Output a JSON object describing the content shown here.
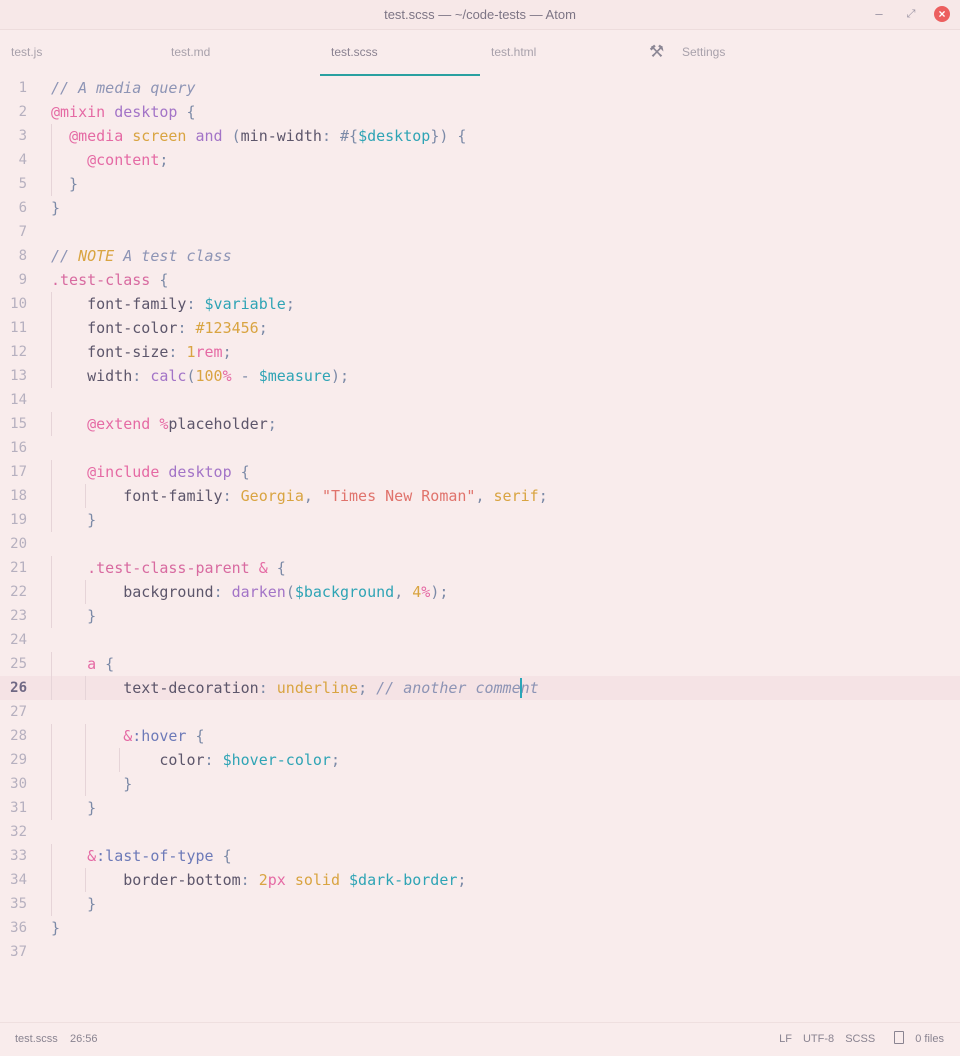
{
  "window": {
    "title": "test.scss — ~/code-tests — Atom",
    "minimize_glyph": "–",
    "maximize_glyph": "⤢",
    "close_glyph": "×"
  },
  "tabs": [
    {
      "label": "test.js",
      "active": false
    },
    {
      "label": "test.md",
      "active": false
    },
    {
      "label": "test.scss",
      "active": true
    },
    {
      "label": "test.html",
      "active": false
    },
    {
      "label": "Settings",
      "active": false,
      "icon": "tools-icon"
    }
  ],
  "editor": {
    "cursor_line": 26,
    "lines": [
      {
        "n": "1",
        "tokens": [
          [
            "// A media query",
            "cm"
          ]
        ]
      },
      {
        "n": "2",
        "tokens": [
          [
            "@",
            "at"
          ],
          [
            "mixin",
            "at"
          ],
          [
            " ",
            "pr"
          ],
          [
            "desktop",
            "kw"
          ],
          [
            " {",
            "pu"
          ]
        ]
      },
      {
        "n": "3",
        "tokens": [
          [
            "  ",
            "pr"
          ],
          [
            "@media",
            "at"
          ],
          [
            " ",
            "pr"
          ],
          [
            "screen",
            "vl"
          ],
          [
            " ",
            "pr"
          ],
          [
            "and",
            "kw"
          ],
          [
            " (",
            "pu"
          ],
          [
            "min-width",
            "pr"
          ],
          [
            ": ",
            "pu"
          ],
          [
            "#{",
            "pu"
          ],
          [
            "$desktop",
            "vr"
          ],
          [
            "}",
            "pu"
          ],
          [
            ") {",
            "pu"
          ]
        ]
      },
      {
        "n": "4",
        "tokens": [
          [
            "    ",
            "pr"
          ],
          [
            "@content",
            "at"
          ],
          [
            ";",
            "pu"
          ]
        ]
      },
      {
        "n": "5",
        "tokens": [
          [
            "  }",
            "pu"
          ]
        ]
      },
      {
        "n": "6",
        "tokens": [
          [
            "}",
            "pu"
          ]
        ]
      },
      {
        "n": "7",
        "tokens": []
      },
      {
        "n": "8",
        "tokens": [
          [
            "// ",
            "cm"
          ],
          [
            "NOTE",
            "nt"
          ],
          [
            " A test class",
            "cm"
          ]
        ]
      },
      {
        "n": "9",
        "tokens": [
          [
            ".test-class",
            "sl"
          ],
          [
            " {",
            "pu"
          ]
        ]
      },
      {
        "n": "10",
        "tokens": [
          [
            "    ",
            "pr"
          ],
          [
            "font-family",
            "pr"
          ],
          [
            ": ",
            "pu"
          ],
          [
            "$variable",
            "vr"
          ],
          [
            ";",
            "pu"
          ]
        ]
      },
      {
        "n": "11",
        "tokens": [
          [
            "    ",
            "pr"
          ],
          [
            "font-color",
            "pr"
          ],
          [
            ": ",
            "pu"
          ],
          [
            "#123456",
            "nm"
          ],
          [
            ";",
            "pu"
          ]
        ]
      },
      {
        "n": "12",
        "tokens": [
          [
            "    ",
            "pr"
          ],
          [
            "font-size",
            "pr"
          ],
          [
            ": ",
            "pu"
          ],
          [
            "1",
            "nm"
          ],
          [
            "rem",
            "at"
          ],
          [
            ";",
            "pu"
          ]
        ]
      },
      {
        "n": "13",
        "tokens": [
          [
            "    ",
            "pr"
          ],
          [
            "width",
            "pr"
          ],
          [
            ": ",
            "pu"
          ],
          [
            "calc",
            "fn"
          ],
          [
            "(",
            "pu"
          ],
          [
            "100",
            "nm"
          ],
          [
            "%",
            "at"
          ],
          [
            " - ",
            "pu"
          ],
          [
            "$measure",
            "vr"
          ],
          [
            ");",
            "pu"
          ]
        ]
      },
      {
        "n": "14",
        "tokens": []
      },
      {
        "n": "15",
        "tokens": [
          [
            "    ",
            "pr"
          ],
          [
            "@extend",
            "at"
          ],
          [
            " ",
            "pr"
          ],
          [
            "%",
            "at"
          ],
          [
            "placeholder",
            ""
          ],
          [
            ";",
            "pu"
          ]
        ]
      },
      {
        "n": "16",
        "tokens": []
      },
      {
        "n": "17",
        "tokens": [
          [
            "    ",
            "pr"
          ],
          [
            "@include",
            "at"
          ],
          [
            " ",
            "pr"
          ],
          [
            "desktop",
            "kw"
          ],
          [
            " {",
            "pu"
          ]
        ]
      },
      {
        "n": "18",
        "tokens": [
          [
            "        ",
            "pr"
          ],
          [
            "font-family",
            "pr"
          ],
          [
            ": ",
            "pu"
          ],
          [
            "Georgia",
            "vl"
          ],
          [
            ", ",
            "pu"
          ],
          [
            "\"Times New Roman\"",
            "st"
          ],
          [
            ", ",
            "pu"
          ],
          [
            "serif",
            "vl"
          ],
          [
            ";",
            "pu"
          ]
        ]
      },
      {
        "n": "19",
        "tokens": [
          [
            "    }",
            "pu"
          ]
        ]
      },
      {
        "n": "20",
        "tokens": []
      },
      {
        "n": "21",
        "tokens": [
          [
            "    ",
            "pr"
          ],
          [
            ".test-class-parent",
            "sl"
          ],
          [
            " ",
            "pr"
          ],
          [
            "&",
            "at"
          ],
          [
            " {",
            "pu"
          ]
        ]
      },
      {
        "n": "22",
        "tokens": [
          [
            "        ",
            "pr"
          ],
          [
            "background",
            "pr"
          ],
          [
            ": ",
            "pu"
          ],
          [
            "darken",
            "fn"
          ],
          [
            "(",
            "pu"
          ],
          [
            "$background",
            "vr"
          ],
          [
            ", ",
            "pu"
          ],
          [
            "4",
            "nm"
          ],
          [
            "%",
            "at"
          ],
          [
            ");",
            "pu"
          ]
        ]
      },
      {
        "n": "23",
        "tokens": [
          [
            "    }",
            "pu"
          ]
        ]
      },
      {
        "n": "24",
        "tokens": []
      },
      {
        "n": "25",
        "tokens": [
          [
            "    ",
            "pr"
          ],
          [
            "a",
            "at"
          ],
          [
            " {",
            "pu"
          ]
        ]
      },
      {
        "n": "26",
        "tokens": [
          [
            "        ",
            "pr"
          ],
          [
            "text-decoration",
            "pr"
          ],
          [
            ": ",
            "pu"
          ],
          [
            "underline",
            "vl"
          ],
          [
            "; ",
            "pu"
          ],
          [
            "// another comment ",
            "cm"
          ]
        ]
      },
      {
        "n": "27",
        "tokens": []
      },
      {
        "n": "28",
        "tokens": [
          [
            "        ",
            "pr"
          ],
          [
            "&",
            "at"
          ],
          [
            ":hover",
            "ps"
          ],
          [
            " {",
            "pu"
          ]
        ]
      },
      {
        "n": "29",
        "tokens": [
          [
            "            ",
            "pr"
          ],
          [
            "color",
            "pr"
          ],
          [
            ": ",
            "pu"
          ],
          [
            "$hover-color",
            "vr"
          ],
          [
            ";",
            "pu"
          ]
        ]
      },
      {
        "n": "30",
        "tokens": [
          [
            "        }",
            "pu"
          ]
        ]
      },
      {
        "n": "31",
        "tokens": [
          [
            "    }",
            "pu"
          ]
        ]
      },
      {
        "n": "32",
        "tokens": []
      },
      {
        "n": "33",
        "tokens": [
          [
            "    ",
            "pr"
          ],
          [
            "&",
            "at"
          ],
          [
            ":last-of-type",
            "ps"
          ],
          [
            " {",
            "pu"
          ]
        ]
      },
      {
        "n": "34",
        "tokens": [
          [
            "        ",
            "pr"
          ],
          [
            "border-bottom",
            "pr"
          ],
          [
            ": ",
            "pu"
          ],
          [
            "2",
            "nm"
          ],
          [
            "px",
            "at"
          ],
          [
            " ",
            "pr"
          ],
          [
            "solid",
            "vl"
          ],
          [
            " ",
            "pr"
          ],
          [
            "$dark-border",
            "vr"
          ],
          [
            ";",
            "pu"
          ]
        ]
      },
      {
        "n": "35",
        "tokens": [
          [
            "    }",
            "pu"
          ]
        ]
      },
      {
        "n": "36",
        "tokens": [
          [
            "}",
            "pu"
          ]
        ]
      },
      {
        "n": "37",
        "tokens": []
      }
    ]
  },
  "statusbar": {
    "file": "test.scss",
    "cursor_position": "26:56",
    "line_ending": "LF",
    "encoding": "UTF-8",
    "grammar": "SCSS",
    "files": "0 files"
  },
  "colors": {
    "background": "#f9ecec",
    "accent": "#2aa0a0",
    "close_button": "#ec5f5f"
  }
}
